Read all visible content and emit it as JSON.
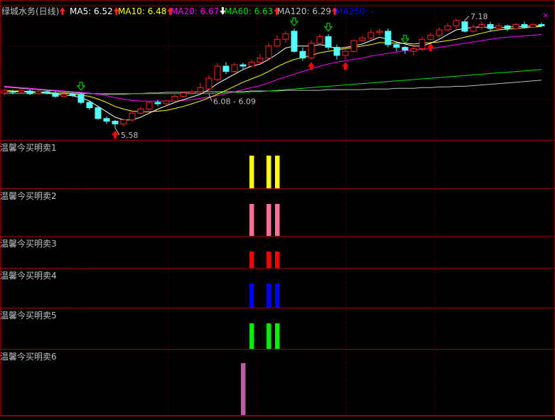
{
  "header": {
    "title": "绿城水务(日线)",
    "title_color": "#c0c0c0",
    "indicators": [
      {
        "label": "MA5:",
        "value": "6.52",
        "arrow": "up",
        "color": "#ffffff"
      },
      {
        "label": "MA10:",
        "value": "6.48",
        "arrow": "up",
        "color": "#ffff00"
      },
      {
        "label": "MA20:",
        "value": "6.67",
        "arrow": "down",
        "color": "#ff00ff"
      },
      {
        "label": "MA60:",
        "value": "6.63",
        "arrow": "up",
        "color": "#00e000"
      },
      {
        "label": "MA120:",
        "value": "6.29",
        "arrow": "up",
        "color": "#c0c0c0"
      },
      {
        "label": "MA250:",
        "value": "-",
        "arrow": "none",
        "color": "#0000ff"
      }
    ]
  },
  "colors": {
    "up_candle": "#ff2222",
    "down_candle": "#55ffff",
    "grid": "#8b0000",
    "dotted_grid": "#6b0000",
    "ma5": "#ffffff",
    "ma10": "#ffff00",
    "ma20": "#ff00ff",
    "ma60": "#00e000",
    "ma120": "#c0c0c0",
    "buy_arrow": "#ff0000",
    "sell_arrow": "#00cc00"
  },
  "chart_data": {
    "type": "candlestick",
    "ylim": [
      5.4,
      7.4
    ],
    "annotations": [
      {
        "text": "5.58",
        "index": 13,
        "value": 5.58
      },
      {
        "text": "7.18",
        "index": 54,
        "value": 7.18
      },
      {
        "text": "6.08 - 6.09",
        "index": 24,
        "value": 6.085
      }
    ],
    "candles": [
      [
        6.1,
        6.14,
        6.06,
        6.16
      ],
      [
        6.12,
        6.11,
        6.08,
        6.15
      ],
      [
        6.11,
        6.14,
        6.1,
        6.17
      ],
      [
        6.13,
        6.09,
        6.07,
        6.15
      ],
      [
        6.09,
        6.12,
        6.08,
        6.14
      ],
      [
        6.12,
        6.1,
        6.08,
        6.14
      ],
      [
        6.1,
        6.05,
        6.03,
        6.13
      ],
      [
        6.05,
        6.08,
        6.04,
        6.1
      ],
      [
        6.08,
        6.06,
        6.04,
        6.11
      ],
      [
        6.08,
        5.96,
        5.93,
        6.1
      ],
      [
        5.96,
        5.88,
        5.85,
        5.98
      ],
      [
        5.88,
        5.72,
        5.7,
        5.91
      ],
      [
        5.72,
        5.68,
        5.64,
        5.75
      ],
      [
        5.68,
        5.64,
        5.58,
        5.7
      ],
      [
        5.64,
        5.7,
        5.6,
        5.72
      ],
      [
        5.7,
        5.8,
        5.68,
        5.84
      ],
      [
        5.8,
        5.86,
        5.78,
        5.9
      ],
      [
        5.86,
        5.96,
        5.84,
        5.98
      ],
      [
        5.96,
        5.94,
        5.9,
        6.0
      ],
      [
        5.94,
        5.98,
        5.92,
        6.0
      ],
      [
        5.98,
        6.05,
        5.96,
        6.08
      ],
      [
        6.05,
        6.1,
        6.03,
        6.12
      ],
      [
        6.1,
        6.12,
        6.08,
        6.15
      ],
      [
        6.12,
        6.18,
        6.1,
        6.25
      ],
      [
        6.16,
        6.32,
        6.14,
        6.36
      ],
      [
        6.3,
        6.5,
        6.28,
        6.54
      ],
      [
        6.5,
        6.42,
        6.38,
        6.56
      ],
      [
        6.42,
        6.52,
        6.4,
        6.55
      ],
      [
        6.52,
        6.5,
        6.46,
        6.55
      ],
      [
        6.5,
        6.56,
        6.48,
        6.6
      ],
      [
        6.56,
        6.62,
        6.54,
        6.68
      ],
      [
        6.62,
        6.8,
        6.6,
        6.84
      ],
      [
        6.8,
        6.9,
        6.78,
        6.96
      ],
      [
        6.9,
        6.98,
        6.85,
        7.02
      ],
      [
        7.02,
        6.72,
        6.7,
        7.06
      ],
      [
        6.72,
        6.62,
        6.58,
        6.78
      ],
      [
        6.62,
        6.84,
        6.6,
        6.88
      ],
      [
        6.84,
        6.94,
        6.8,
        6.98
      ],
      [
        6.94,
        6.78,
        6.74,
        6.98
      ],
      [
        6.78,
        6.66,
        6.6,
        6.82
      ],
      [
        6.66,
        6.72,
        6.6,
        6.76
      ],
      [
        6.72,
        6.88,
        6.7,
        6.9
      ],
      [
        6.88,
        6.92,
        6.86,
        6.96
      ],
      [
        6.92,
        7.0,
        6.9,
        7.04
      ],
      [
        7.0,
        7.02,
        6.96,
        7.06
      ],
      [
        7.02,
        6.82,
        6.78,
        7.06
      ],
      [
        6.82,
        6.78,
        6.72,
        6.86
      ],
      [
        6.78,
        6.74,
        6.68,
        6.8
      ],
      [
        6.72,
        6.76,
        6.66,
        6.8
      ],
      [
        6.76,
        6.9,
        6.72,
        6.94
      ],
      [
        6.9,
        6.96,
        6.88,
        7.0
      ],
      [
        6.96,
        7.04,
        6.92,
        7.08
      ],
      [
        7.04,
        7.1,
        7.02,
        7.14
      ],
      [
        7.1,
        7.18,
        7.06,
        7.2
      ],
      [
        7.16,
        7.02,
        7.0,
        7.18
      ],
      [
        7.02,
        7.08,
        7.0,
        7.12
      ],
      [
        7.08,
        7.12,
        7.04,
        7.16
      ],
      [
        7.12,
        7.06,
        7.02,
        7.16
      ],
      [
        7.06,
        7.1,
        7.04,
        7.14
      ],
      [
        7.1,
        7.06,
        7.02,
        7.12
      ],
      [
        7.06,
        7.12,
        7.04,
        7.14
      ],
      [
        7.12,
        7.08,
        7.06,
        7.16
      ],
      [
        7.08,
        7.12,
        7.06,
        7.14
      ],
      [
        7.12,
        7.1,
        7.08,
        7.15
      ]
    ],
    "ma5": [
      6.12,
      6.12,
      6.12,
      6.11,
      6.11,
      6.1,
      6.08,
      6.07,
      6.06,
      6.03,
      5.98,
      5.9,
      5.82,
      5.74,
      5.7,
      5.7,
      5.74,
      5.8,
      5.86,
      5.91,
      5.96,
      6.0,
      6.04,
      6.08,
      6.15,
      6.24,
      6.31,
      6.38,
      6.45,
      6.5,
      6.53,
      6.6,
      6.68,
      6.77,
      6.8,
      6.8,
      6.8,
      6.82,
      6.8,
      6.76,
      6.78,
      6.8,
      6.83,
      6.88,
      6.93,
      6.9,
      6.86,
      6.83,
      6.8,
      6.8,
      6.84,
      6.9,
      6.97,
      7.04,
      7.06,
      7.08,
      7.08,
      7.08,
      7.07,
      7.08,
      7.09,
      7.09,
      7.1,
      7.1
    ],
    "ma10": [
      6.14,
      6.13,
      6.13,
      6.12,
      6.12,
      6.11,
      6.1,
      6.1,
      6.09,
      6.07,
      6.05,
      6.01,
      5.96,
      5.9,
      5.86,
      5.83,
      5.82,
      5.82,
      5.83,
      5.84,
      5.87,
      5.9,
      5.94,
      5.98,
      6.03,
      6.08,
      6.14,
      6.2,
      6.26,
      6.31,
      6.36,
      6.42,
      6.49,
      6.55,
      6.6,
      6.63,
      6.66,
      6.7,
      6.72,
      6.74,
      6.76,
      6.78,
      6.8,
      6.82,
      6.85,
      6.85,
      6.84,
      6.84,
      6.83,
      6.84,
      6.85,
      6.86,
      6.88,
      6.9,
      6.93,
      6.96,
      6.99,
      7.02,
      7.04,
      7.05,
      7.06,
      7.07,
      7.08,
      7.09
    ],
    "ma20": [
      6.2,
      6.19,
      6.18,
      6.17,
      6.16,
      6.15,
      6.14,
      6.13,
      6.12,
      6.11,
      6.1,
      6.08,
      6.06,
      6.03,
      6.01,
      5.99,
      5.98,
      5.98,
      5.98,
      5.98,
      5.98,
      5.99,
      6.0,
      6.02,
      6.04,
      6.06,
      6.09,
      6.12,
      6.15,
      6.18,
      6.21,
      6.25,
      6.3,
      6.34,
      6.38,
      6.42,
      6.46,
      6.5,
      6.53,
      6.56,
      6.58,
      6.6,
      6.62,
      6.65,
      6.67,
      6.69,
      6.71,
      6.73,
      6.74,
      6.75,
      6.76,
      6.78,
      6.8,
      6.82,
      6.84,
      6.86,
      6.88,
      6.9,
      6.92,
      6.93,
      6.94,
      6.95,
      6.96,
      6.97
    ],
    "ma60": [
      6.09,
      6.09,
      6.09,
      6.09,
      6.09,
      6.09,
      6.09,
      6.09,
      6.09,
      6.09,
      6.09,
      6.09,
      6.09,
      6.09,
      6.09,
      6.09,
      6.09,
      6.09,
      6.09,
      6.09,
      6.09,
      6.09,
      6.09,
      6.09,
      6.09,
      6.1,
      6.1,
      6.11,
      6.11,
      6.12,
      6.12,
      6.13,
      6.14,
      6.15,
      6.16,
      6.17,
      6.18,
      6.19,
      6.2,
      6.21,
      6.22,
      6.23,
      6.24,
      6.25,
      6.26,
      6.27,
      6.28,
      6.29,
      6.3,
      6.31,
      6.32,
      6.33,
      6.34,
      6.35,
      6.36,
      6.37,
      6.38,
      6.39,
      6.4,
      6.41,
      6.42,
      6.43,
      6.44,
      6.45
    ],
    "ma120": [
      6.19,
      6.18,
      6.17,
      6.16,
      6.15,
      6.14,
      6.13,
      6.12,
      6.11,
      6.1,
      6.09,
      6.09,
      6.08,
      6.08,
      6.08,
      6.09,
      6.09,
      6.1,
      6.1,
      6.11,
      6.11,
      6.11,
      6.11,
      6.12,
      6.12,
      6.12,
      6.12,
      6.12,
      6.12,
      6.13,
      6.13,
      6.13,
      6.13,
      6.14,
      6.14,
      6.14,
      6.14,
      6.14,
      6.15,
      6.15,
      6.15,
      6.15,
      6.15,
      6.16,
      6.16,
      6.16,
      6.17,
      6.17,
      6.17,
      6.18,
      6.18,
      6.19,
      6.19,
      6.2,
      6.2,
      6.21,
      6.22,
      6.23,
      6.24,
      6.25,
      6.26,
      6.27,
      6.28,
      6.29
    ],
    "buy_markers": [
      13,
      36,
      40,
      50
    ],
    "sell_markers": [
      9,
      34,
      38,
      47
    ],
    "panels": [
      {
        "label": "温馨今买明卖1",
        "color": "#ffff00",
        "bars": [
          29,
          31,
          32
        ]
      },
      {
        "label": "温馨今买明卖2",
        "color": "#ff6e96",
        "bars": [
          29,
          31,
          32
        ]
      },
      {
        "label": "温馨今买明卖3",
        "color": "#ff0000",
        "bars": [
          29,
          31,
          32
        ]
      },
      {
        "label": "温馨今买明卖4",
        "color": "#0000ff",
        "bars": [
          29,
          31,
          32
        ]
      },
      {
        "label": "温馨今买明卖5",
        "color": "#00ee00",
        "bars": [
          29,
          31,
          32
        ]
      },
      {
        "label": "温馨今买明卖6",
        "color": "#b85fa0",
        "bars": [
          28
        ]
      }
    ]
  }
}
